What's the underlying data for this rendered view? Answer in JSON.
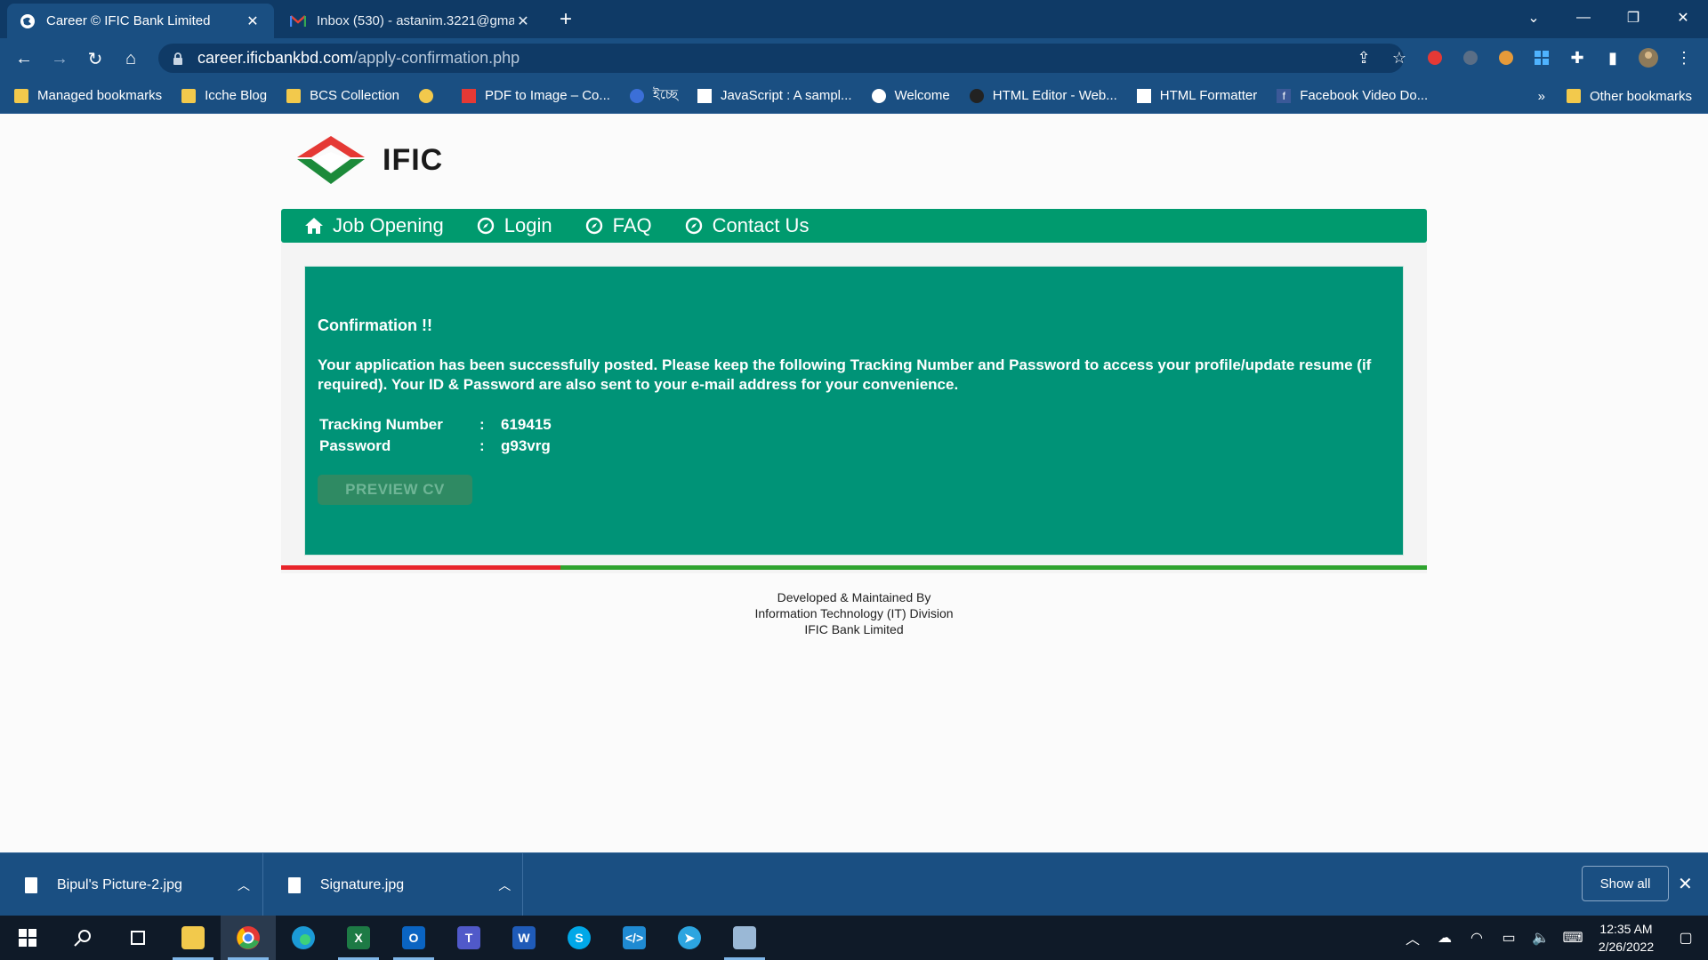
{
  "browser": {
    "tabs": [
      {
        "title": "Career © IFIC Bank Limited",
        "active": true
      },
      {
        "title": "Inbox (530) - astanim.3221@gma",
        "active": false
      }
    ],
    "url_host": "career.ificbankbd.com",
    "url_path": "/apply-confirmation.php",
    "bookmarks": [
      {
        "label": "Managed bookmarks",
        "icon": "folder-icon"
      },
      {
        "label": "Icche Blog",
        "icon": "folder-icon"
      },
      {
        "label": "BCS Collection",
        "icon": "folder-icon"
      },
      {
        "label": "",
        "icon": "people-icon"
      },
      {
        "label": "PDF to Image – Co...",
        "icon": "pdf-icon"
      },
      {
        "label": "ইচ্ছে",
        "icon": "ichche-icon"
      },
      {
        "label": "JavaScript : A sampl...",
        "icon": "w3-icon"
      },
      {
        "label": "Welcome",
        "icon": "globe-icon"
      },
      {
        "label": "HTML Editor - Web...",
        "icon": "spy-icon"
      },
      {
        "label": "HTML Formatter",
        "icon": "formatter-icon"
      },
      {
        "label": "Facebook Video Do...",
        "icon": "facebook-icon"
      }
    ],
    "more_bookmarks": "»",
    "other_bookmarks": "Other bookmarks"
  },
  "site": {
    "logo_text": "IFIC",
    "nav": [
      {
        "label": "Job Opening",
        "icon": "home-icon"
      },
      {
        "label": "Login",
        "icon": "compass-icon"
      },
      {
        "label": "FAQ",
        "icon": "compass-icon"
      },
      {
        "label": "Contact Us",
        "icon": "compass-icon"
      }
    ],
    "confirmation": {
      "title": "Confirmation !!",
      "message": "Your application has been successfully posted. Please keep the following Tracking Number and Password to access your profile/update resume (if required). Your ID & Password are also sent to your e-mail address for your convenience.",
      "tracking_label": "Tracking Number",
      "tracking_value": "619415",
      "password_label": "Password",
      "password_value": "g93vrg",
      "separator": ":",
      "preview_button": "PREVIEW CV"
    },
    "footer": {
      "line1": "Developed & Maintained By",
      "line2": "Information Technology (IT) Division",
      "line3": "IFIC Bank Limited"
    }
  },
  "downloads": {
    "items": [
      {
        "name": "Bipul's Picture-2.jpg"
      },
      {
        "name": "Signature.jpg"
      }
    ],
    "show_all": "Show all"
  },
  "taskbar": {
    "time": "12:35 AM",
    "date": "2/26/2022"
  },
  "colors": {
    "brand_green": "#009377",
    "nav_green": "#009a6e",
    "accent_red": "#e8242a"
  }
}
